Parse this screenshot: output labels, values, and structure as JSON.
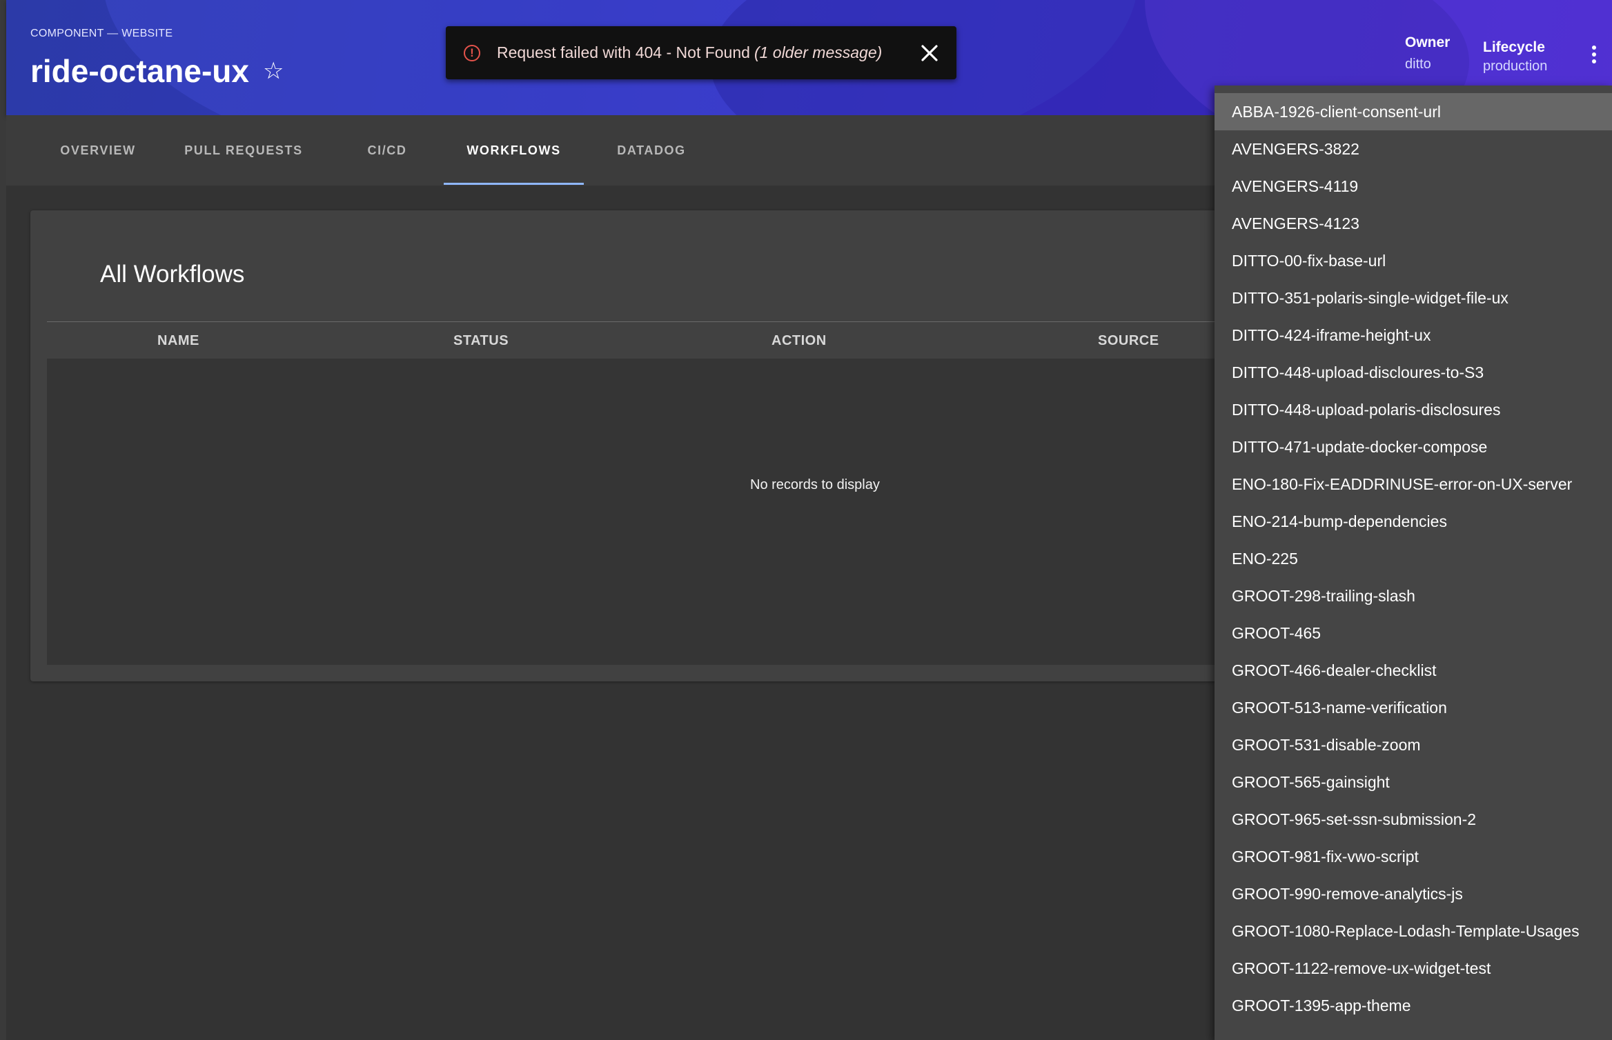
{
  "header": {
    "breadcrumb": "COMPONENT — WEBSITE",
    "title": "ride-octane-ux",
    "owner_label": "Owner",
    "owner_value": "ditto",
    "lifecycle_label": "Lifecycle",
    "lifecycle_value": "production"
  },
  "snackbar": {
    "message": "Request failed with 404 - Not Found",
    "older": "(1 older message)"
  },
  "tabs": [
    {
      "label": "OVERVIEW"
    },
    {
      "label": "PULL REQUESTS"
    },
    {
      "label": "CI/CD"
    },
    {
      "label": "WORKFLOWS"
    },
    {
      "label": "DATADOG"
    }
  ],
  "workflows": {
    "title": "All Workflows",
    "columns": [
      "NAME",
      "STATUS",
      "ACTION",
      "SOURCE"
    ],
    "empty_text": "No records to display"
  },
  "dropdown": {
    "items": [
      "ABBA-1926-client-consent-url",
      "AVENGERS-3822",
      "AVENGERS-4119",
      "AVENGERS-4123",
      "DITTO-00-fix-base-url",
      "DITTO-351-polaris-single-widget-file-ux",
      "DITTO-424-iframe-height-ux",
      "DITTO-448-upload-discloures-to-S3",
      "DITTO-448-upload-polaris-disclosures",
      "DITTO-471-update-docker-compose",
      "ENO-180-Fix-EADDRINUSE-error-on-UX-server",
      "ENO-214-bump-dependencies",
      "ENO-225",
      "GROOT-298-trailing-slash",
      "GROOT-465",
      "GROOT-466-dealer-checklist",
      "GROOT-513-name-verification",
      "GROOT-531-disable-zoom",
      "GROOT-565-gainsight",
      "GROOT-965-set-ssn-submission-2",
      "GROOT-981-fix-vwo-script",
      "GROOT-990-remove-analytics-js",
      "GROOT-1080-Replace-Lodash-Template-Usages",
      "GROOT-1122-remove-ux-widget-test",
      "GROOT-1395-app-theme"
    ]
  },
  "colors": {
    "header_gradient_start": "#2c3aa8",
    "header_gradient_end": "#4a2ad0",
    "tab_indicator": "#8fb7ff",
    "error": "#e5534b",
    "selected_item": "#676767"
  }
}
